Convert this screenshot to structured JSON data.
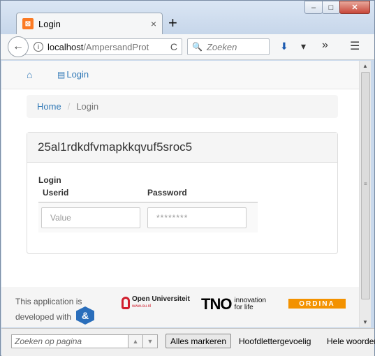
{
  "window": {
    "minimize_glyph": "–",
    "maximize_glyph": "□",
    "close_glyph": "✕"
  },
  "tab": {
    "title": "Login",
    "close_glyph": "×",
    "new_tab_glyph": "+"
  },
  "nav": {
    "back_glyph": "←",
    "info_glyph": "i",
    "url_host": "localhost",
    "url_path": "/AmpersandProt",
    "reload_glyph": "C",
    "search_placeholder": "Zoeken",
    "search_glyph": "🔍",
    "download_glyph": "⬇",
    "dropdown_glyph": "▾",
    "overflow_glyph": "»",
    "menu_glyph": "☰"
  },
  "app_nav": {
    "home_glyph": "⌂",
    "login_label": "Login",
    "list_glyph": "▤"
  },
  "breadcrumb": {
    "home": "Home",
    "separator": "/",
    "current": "Login"
  },
  "panel": {
    "heading": "25al1rdkdfvmapkkqvuf5sroc5",
    "form_label": "Login",
    "columns": [
      "Userid",
      "Password"
    ],
    "userid_placeholder": "Value",
    "password_value": "********"
  },
  "footer": {
    "line1": "This application is",
    "line2": "developed with",
    "amp_glyph": "&",
    "ou_name": "Open Universiteit",
    "ou_url": "www.ou.nl",
    "tno_name": "TNO",
    "tno_tag1": "innovation",
    "tno_tag2": "for life",
    "ordina_name": "ORDINA"
  },
  "findbar": {
    "placeholder": "Zoeken op pagina",
    "up_glyph": "▲",
    "down_glyph": "▼",
    "mark_all": "Alles markeren",
    "match_case": "Hoofdlettergevoelig",
    "whole_words": "Hele woorden"
  },
  "colors": {
    "link": "#337ab7",
    "tab_logo": "#fb7a24",
    "ou_red": "#d01e2d",
    "ordina_orange": "#f39200",
    "amp_blue": "#2a6ebb"
  }
}
